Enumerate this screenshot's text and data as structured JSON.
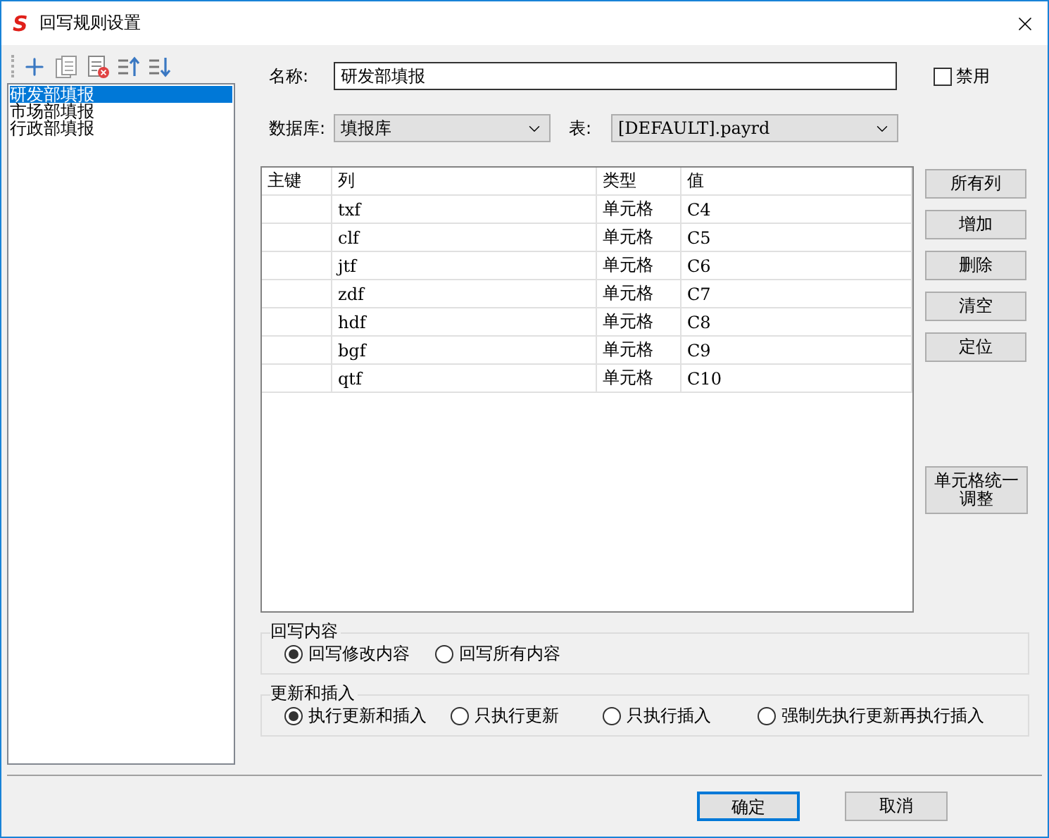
{
  "window": {
    "logo": "S",
    "title": "回写规则设置"
  },
  "rules": [
    {
      "label": "研发部填报",
      "selected": true
    },
    {
      "label": "市场部填报",
      "selected": false
    },
    {
      "label": "行政部填报",
      "selected": false
    }
  ],
  "form": {
    "name_label": "名称:",
    "name_value": "研发部填报",
    "disable": {
      "label": "禁用",
      "checked": false
    },
    "database_label": "数据库:",
    "database_value": "填报库",
    "table_label": "表:",
    "table_value": "[DEFAULT].payrd"
  },
  "grid": {
    "columns": [
      "主键",
      "列",
      "类型",
      "值"
    ],
    "rows": [
      {
        "column": "txf",
        "type": "单元格",
        "value": "C4"
      },
      {
        "column": "clf",
        "type": "单元格",
        "value": "C5"
      },
      {
        "column": "jtf",
        "type": "单元格",
        "value": "C6"
      },
      {
        "column": "zdf",
        "type": "单元格",
        "value": "C7"
      },
      {
        "column": "hdf",
        "type": "单元格",
        "value": "C8"
      },
      {
        "column": "bgf",
        "type": "单元格",
        "value": "C9"
      },
      {
        "column": "qtf",
        "type": "单元格",
        "value": "C10"
      }
    ]
  },
  "side_buttons": [
    "所有列",
    "增加",
    "删除",
    "清空",
    "定位"
  ],
  "adjust_button": "单元格统一调整",
  "groups": [
    {
      "title": "回写内容",
      "options": [
        {
          "label": "回写修改内容",
          "selected": true
        },
        {
          "label": "回写所有内容",
          "selected": false
        }
      ]
    },
    {
      "title": "更新和插入",
      "options": [
        {
          "label": "执行更新和插入",
          "selected": true
        },
        {
          "label": "只执行更新",
          "selected": false
        },
        {
          "label": "只执行插入",
          "selected": false
        },
        {
          "label": "强制先执行更新再执行插入",
          "selected": false
        }
      ]
    }
  ],
  "buttons": [
    {
      "label": "确定",
      "default": true
    },
    {
      "label": "取消",
      "default": false
    }
  ]
}
